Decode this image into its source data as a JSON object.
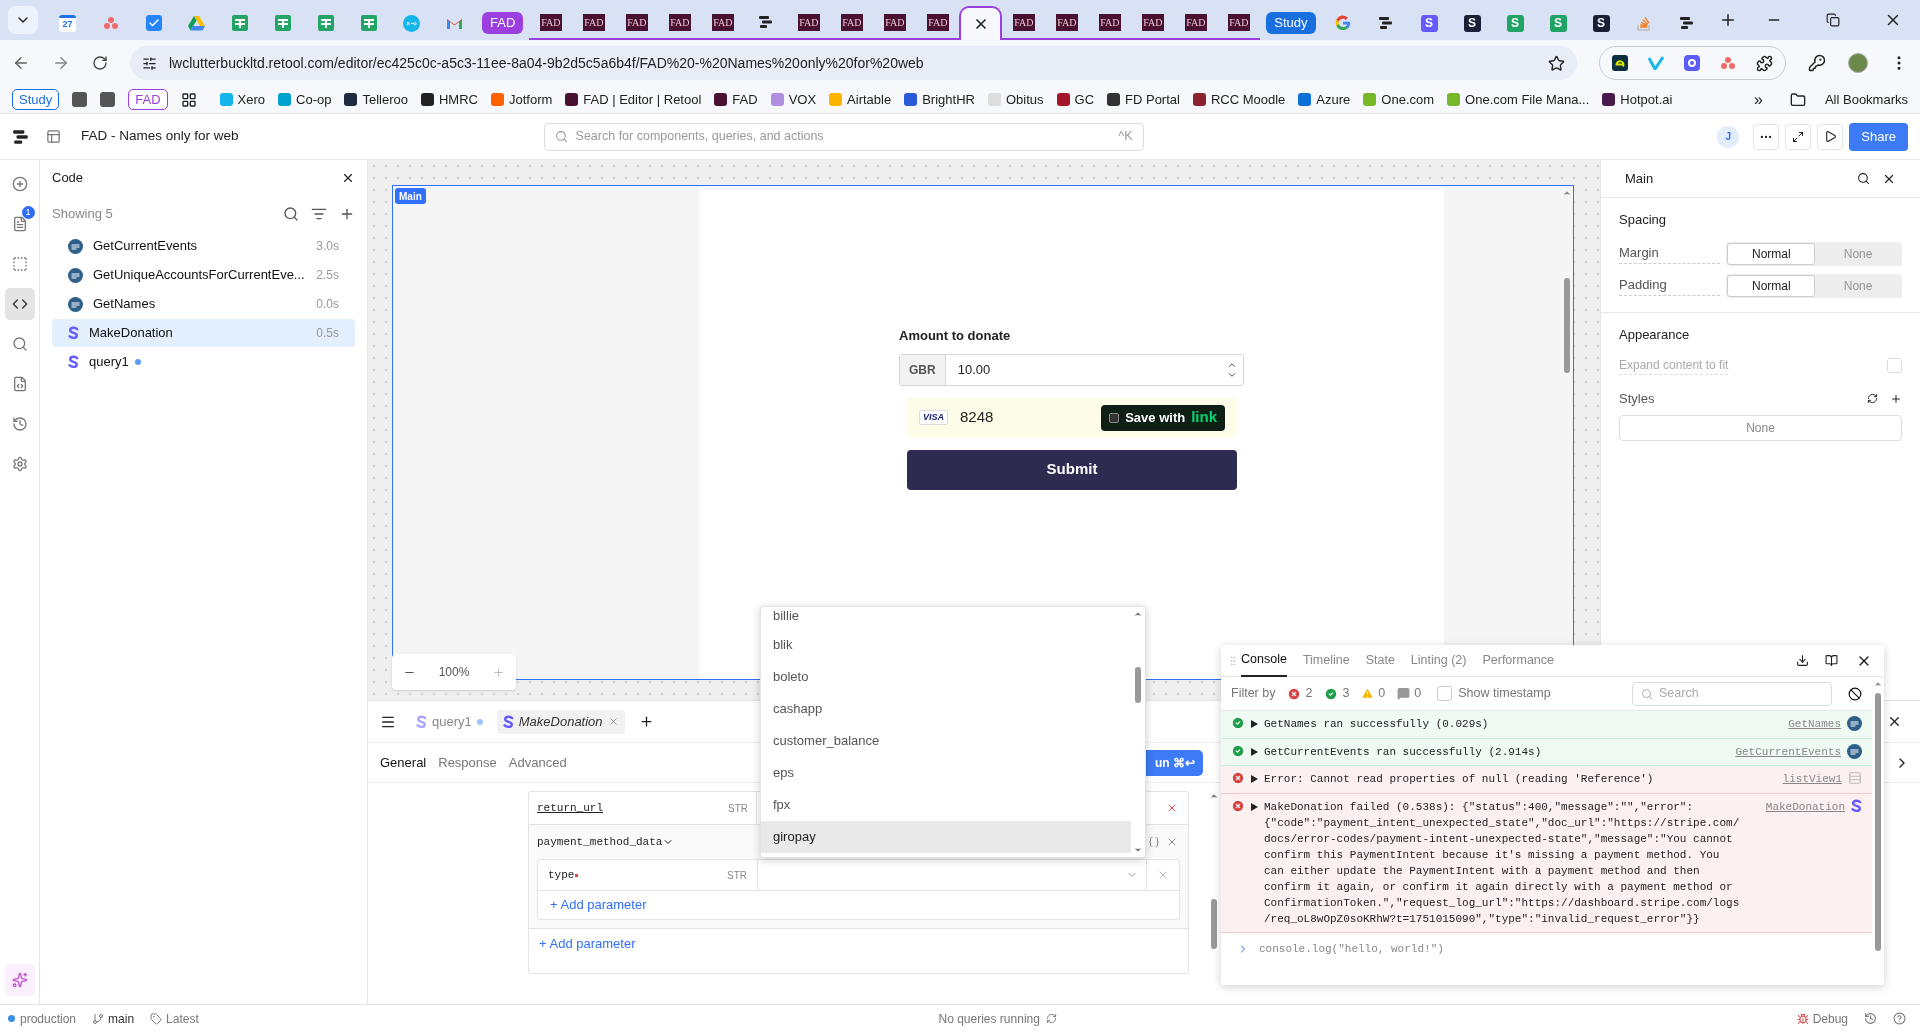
{
  "browser": {
    "tabs": [
      {
        "kind": "calendar",
        "label": "27",
        "selected": false,
        "in_group": false
      },
      {
        "kind": "asana",
        "selected": false,
        "in_group": false
      },
      {
        "kind": "tasks",
        "selected": false,
        "in_group": false
      },
      {
        "kind": "drive",
        "selected": false,
        "in_group": false
      },
      {
        "kind": "sheets",
        "selected": false,
        "in_group": false
      },
      {
        "kind": "sheets",
        "selected": false,
        "in_group": false
      },
      {
        "kind": "sheets",
        "selected": false,
        "in_group": false
      },
      {
        "kind": "sheets",
        "selected": false,
        "in_group": false
      },
      {
        "kind": "xero",
        "selected": false,
        "in_group": false
      },
      {
        "kind": "gmail",
        "selected": false,
        "in_group": false
      },
      {
        "kind": "pill",
        "label": "FAD",
        "color": "#9b3fe0",
        "selected": false,
        "in_group": false
      },
      {
        "kind": "fad",
        "label": "FAD",
        "selected": false,
        "in_group": true
      },
      {
        "kind": "fad",
        "label": "FAD",
        "selected": false,
        "in_group": true
      },
      {
        "kind": "fad",
        "label": "FAD",
        "selected": false,
        "in_group": true
      },
      {
        "kind": "fad",
        "label": "FAD",
        "selected": false,
        "in_group": true
      },
      {
        "kind": "fad",
        "label": "FAD",
        "selected": false,
        "in_group": true
      },
      {
        "kind": "retool",
        "selected": false,
        "in_group": true
      },
      {
        "kind": "fad",
        "label": "FAD",
        "selected": false,
        "in_group": true
      },
      {
        "kind": "fad",
        "label": "FAD",
        "selected": false,
        "in_group": true
      },
      {
        "kind": "fad",
        "label": "FAD",
        "selected": false,
        "in_group": true
      },
      {
        "kind": "fad",
        "label": "FAD",
        "selected": false,
        "in_group": true
      },
      {
        "kind": "blank",
        "selected": true,
        "in_group": true
      },
      {
        "kind": "fad",
        "label": "FAD",
        "selected": false,
        "in_group": true
      },
      {
        "kind": "fad",
        "label": "FAD",
        "selected": false,
        "in_group": true
      },
      {
        "kind": "fad",
        "label": "FAD",
        "selected": false,
        "in_group": true
      },
      {
        "kind": "fad",
        "label": "FAD",
        "selected": false,
        "in_group": true
      },
      {
        "kind": "fad",
        "label": "FAD",
        "selected": false,
        "in_group": true
      },
      {
        "kind": "fad",
        "label": "FAD",
        "selected": false,
        "in_group": true
      },
      {
        "kind": "pill",
        "label": "Study",
        "color": "#1a6fe0",
        "selected": false,
        "in_group": false
      },
      {
        "kind": "google",
        "selected": false,
        "in_group": false
      },
      {
        "kind": "retool",
        "selected": false,
        "in_group": false
      },
      {
        "kind": "s",
        "label": "S",
        "color": "#635bff",
        "selected": false,
        "in_group": false
      },
      {
        "kind": "s",
        "label": "S",
        "color": "#1a1f36",
        "selected": false,
        "in_group": false
      },
      {
        "kind": "s",
        "label": "S",
        "color": "#21a366",
        "selected": false,
        "in_group": false
      },
      {
        "kind": "s",
        "label": "S",
        "color": "#21a366",
        "selected": false,
        "in_group": false
      },
      {
        "kind": "s",
        "label": "S",
        "color": "#1a1f36",
        "selected": false,
        "in_group": false
      },
      {
        "kind": "stack",
        "selected": false,
        "in_group": false
      },
      {
        "kind": "retool",
        "selected": false,
        "in_group": false
      }
    ],
    "address": "lwclutterbuckltd.retool.com/editor/ec425c0c-a5c3-11ee-8a04-9b2d5c5a6b4f/FAD%20-%20Names%20only%20for%20web",
    "bookmarks": [
      {
        "kind": "pill",
        "label": "Study",
        "color": "#1a6fe0"
      },
      {
        "kind": "square",
        "color": "#555555"
      },
      {
        "kind": "square",
        "color": "#555555"
      },
      {
        "kind": "pill",
        "label": "FAD",
        "color": "#9b3fe0"
      },
      {
        "kind": "apps"
      },
      {
        "kind": "link",
        "label": "Xero",
        "color": "#13b5ea"
      },
      {
        "kind": "link",
        "label": "Co-op",
        "color": "#00a1cc"
      },
      {
        "kind": "link",
        "label": "Telleroo",
        "color": "#1d2d3e"
      },
      {
        "kind": "link",
        "label": "HMRC",
        "color": "#222222"
      },
      {
        "kind": "link",
        "label": "Jotform",
        "color": "#ff6100"
      },
      {
        "kind": "link",
        "label": "FAD | Editor | Retool",
        "color": "#4a1030"
      },
      {
        "kind": "link",
        "label": "FAD",
        "color": "#4a1030"
      },
      {
        "kind": "link",
        "label": "VOX",
        "color": "#b18fe0"
      },
      {
        "kind": "link",
        "label": "Airtable",
        "color": "#fcb400"
      },
      {
        "kind": "link",
        "label": "BrightHR",
        "color": "#2a5bd7"
      },
      {
        "kind": "link",
        "label": "Obitus",
        "color": "#dddddd"
      },
      {
        "kind": "link",
        "label": "GC",
        "color": "#a3152a"
      },
      {
        "kind": "link",
        "label": "FD Portal",
        "color": "#333333"
      },
      {
        "kind": "link",
        "label": "RCC Moodle",
        "color": "#8b2230"
      },
      {
        "kind": "link",
        "label": "Azure",
        "color": "#0a6fd6"
      },
      {
        "kind": "link",
        "label": "One.com",
        "color": "#76b82a"
      },
      {
        "kind": "link",
        "label": "One.com File Mana...",
        "color": "#76b82a"
      },
      {
        "kind": "link",
        "label": "Hotpot.ai",
        "color": "#4a1a4a"
      }
    ],
    "more": "»",
    "all_bookmarks": "All Bookmarks"
  },
  "app_bar": {
    "title": "FAD - Names only for web",
    "search_placeholder": "Search for components, queries, and actions",
    "shortcut": "^K",
    "avatar": "J",
    "share": "Share"
  },
  "rail": [
    {
      "kind": "add",
      "selected": false
    },
    {
      "kind": "pages",
      "selected": false,
      "badge": "1"
    },
    {
      "kind": "components",
      "selected": false
    },
    {
      "kind": "code",
      "selected": true
    },
    {
      "kind": "search",
      "selected": false
    },
    {
      "kind": "file",
      "selected": false
    },
    {
      "kind": "history",
      "selected": false
    },
    {
      "kind": "settings",
      "selected": false
    },
    {
      "kind": "assist",
      "selected": false
    }
  ],
  "code_panel": {
    "title": "Code",
    "count": "Showing 5",
    "items": [
      {
        "name": "GetCurrentEvents",
        "kind": "sql",
        "time": "3.0s",
        "selected": false,
        "modified": false
      },
      {
        "name": "GetUniqueAccountsForCurrentEve...",
        "kind": "sql",
        "time": "2.5s",
        "selected": false,
        "modified": false
      },
      {
        "name": "GetNames",
        "kind": "sql",
        "time": "0.0s",
        "selected": false,
        "modified": false
      },
      {
        "name": "MakeDonation",
        "kind": "stripe",
        "time": "0.5s",
        "selected": true,
        "modified": false
      },
      {
        "name": "query1",
        "kind": "stripe",
        "selected": false,
        "modified": true
      }
    ]
  },
  "canvas": {
    "frame_label": "Main",
    "form": {
      "label": "Amount to donate",
      "currency": "GBR",
      "amount": "10.00",
      "card_brand": "VISA",
      "card_last4": "8248",
      "link_text": "Save with",
      "link_brand": "link",
      "submit": "Submit"
    },
    "zoom": "100%"
  },
  "inspector": {
    "title": "Main",
    "sections": [
      {
        "title": "Spacing",
        "rows": [
          {
            "label": "Margin",
            "options": [
              {
                "label": "Normal",
                "selected": true
              },
              {
                "label": "None",
                "selected": false
              }
            ]
          },
          {
            "label": "Padding",
            "options": [
              {
                "label": "Normal",
                "selected": true
              },
              {
                "label": "None",
                "selected": false
              }
            ]
          }
        ]
      }
    ],
    "appearance": {
      "title": "Appearance",
      "expand_label": "Expand content to fit",
      "expand_checked": false,
      "styles_label": "Styles",
      "styles_value": "None"
    }
  },
  "query_editor": {
    "tabs": [
      {
        "name": "query1",
        "modified": true,
        "selected": false
      },
      {
        "name": "MakeDonation",
        "modified": false,
        "selected": true
      }
    ],
    "subtabs": [
      {
        "label": "General",
        "selected": true
      },
      {
        "label": "Response",
        "selected": false
      },
      {
        "label": "Advanced",
        "selected": false
      }
    ],
    "run": "un ⌘↩",
    "params": [
      {
        "name": "return_url",
        "type": "STR"
      }
    ],
    "group": {
      "name": "payment_method_data",
      "children": [
        {
          "name": "type",
          "type": "STR",
          "required": true
        }
      ],
      "add": "+ Add parameter"
    },
    "add": "+ Add parameter"
  },
  "dropdown": {
    "options": [
      {
        "label": "billie",
        "selected": false
      },
      {
        "label": "blik",
        "selected": false
      },
      {
        "label": "boleto",
        "selected": false
      },
      {
        "label": "cashapp",
        "selected": false
      },
      {
        "label": "customer_balance",
        "selected": false
      },
      {
        "label": "eps",
        "selected": false
      },
      {
        "label": "fpx",
        "selected": false
      },
      {
        "label": "giropay",
        "selected": true
      }
    ]
  },
  "console": {
    "tabs": [
      {
        "label": "Console",
        "selected": true
      },
      {
        "label": "Timeline",
        "selected": false
      },
      {
        "label": "State",
        "selected": false
      },
      {
        "label": "Linting (2)",
        "selected": false
      },
      {
        "label": "Performance",
        "selected": false
      }
    ],
    "filter_label": "Filter by",
    "filters": [
      {
        "kind": "error",
        "count": "2"
      },
      {
        "kind": "success",
        "count": "3"
      },
      {
        "kind": "warning",
        "count": "0"
      },
      {
        "kind": "info",
        "count": "0"
      }
    ],
    "timestamp_label": "Show timestamp",
    "timestamp_checked": false,
    "search_placeholder": "Search",
    "entries": [
      {
        "kind": "success",
        "text": "GetNames ran successfully (0.029s)",
        "source": {
          "name": "GetNames",
          "kind": "sql"
        }
      },
      {
        "kind": "success",
        "text": "GetCurrentEvents ran successfully (2.914s)",
        "source": {
          "name": "GetCurrentEvents",
          "kind": "sql"
        }
      },
      {
        "kind": "error",
        "text": "Error: Cannot read properties of null (reading 'Reference')",
        "source": {
          "name": "listView1",
          "kind": "list"
        }
      },
      {
        "kind": "error",
        "text": "MakeDonation failed (0.538s): {\"status\":400,\"message\":\"\",\"error\": {\"code\":\"payment_intent_unexpected_state\",\"doc_url\":\"https://stripe.com/docs/error-codes/payment-intent-unexpected-state\",\"message\":\"You cannot confirm this PaymentIntent because it's missing a payment method. You can either update the PaymentIntent with a payment method and then confirm it again, or confirm it again directly with a payment method or ConfirmationToken.\",\"request_log_url\":\"https://dashboard.stripe.com/logs/req_oL8wOpZ0soKRhW?t=1751015090\",\"type\":\"invalid_request_error\"}}",
        "source": {
          "name": "MakeDonation",
          "kind": "stripe"
        }
      }
    ],
    "prompt": "console.log(\"hello, world!\")"
  },
  "status_bar": {
    "environment": "production",
    "branch": "main",
    "version": "Latest",
    "queries": "No queries running",
    "debug": "Debug"
  }
}
